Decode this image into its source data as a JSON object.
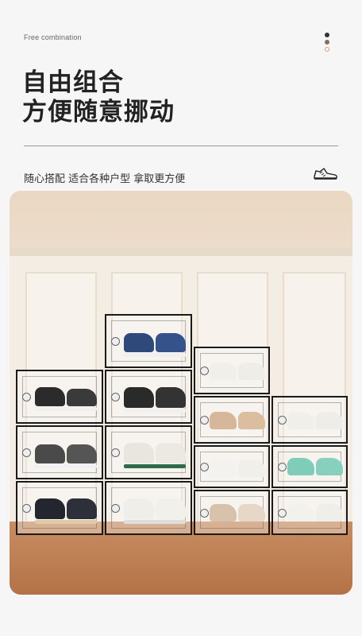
{
  "header": {
    "eyebrow": "Free combination",
    "title_line1": "自由组合",
    "title_line2": "方便随意挪动",
    "subtitle": "随心搭配 适合各种户型 拿取更方便",
    "dot_colors": [
      "#333333",
      "#8a6b5a",
      "#c8a48a"
    ],
    "icon": "sneaker-icon"
  },
  "photo": {
    "description_icon": "shoe-boxes-photo"
  }
}
